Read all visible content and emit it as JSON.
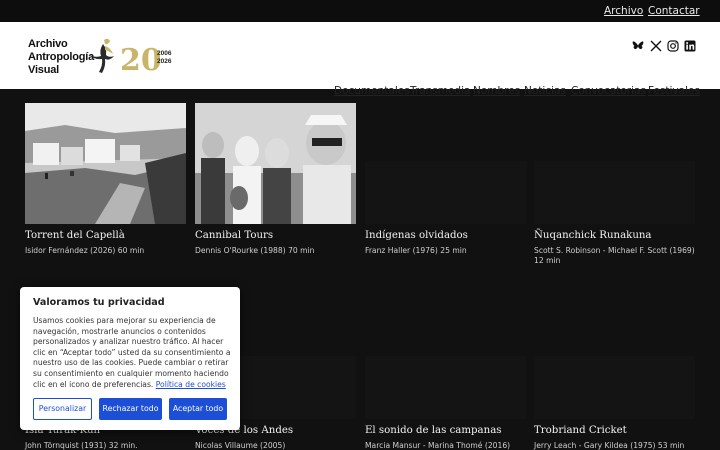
{
  "topbar": {
    "links": [
      "Archivo",
      "Contactar"
    ]
  },
  "header": {
    "logo_lines": [
      "Archivo",
      "Antropología",
      "Visual"
    ],
    "logo_years": [
      "2006",
      "2026"
    ],
    "social_icons": [
      "bluesky-icon",
      "x-icon",
      "instagram-icon",
      "linkedin-icon"
    ],
    "nav": [
      "Documentales",
      "Transmedia",
      "Nombres",
      "Noticias",
      "Convocatorias",
      "Festivales"
    ]
  },
  "films": [
    {
      "title": "Torrent del Capellà",
      "meta": "Isidor Fernández (2026) 60 min"
    },
    {
      "title": "Cannibal Tours",
      "meta": "Dennis O'Rourke (1988) 70 min"
    },
    {
      "title": "Indígenas olvidados",
      "meta": "Franz Haller (1976) 25 min"
    },
    {
      "title": "Ñuqanchick Runakuna",
      "meta": "Scott S. Robinson - Michael F. Scott (1969) 12 min"
    },
    {
      "title": "Isla Yurak-Kuh",
      "meta": "John Törnquist (1931) 32 min."
    },
    {
      "title": "Voces de los Andes",
      "meta": "Nicolas Villaume (2005)"
    },
    {
      "title": "El sonido de las campanas",
      "meta": "Marcia Mansur - Marina Thomé (2016)"
    },
    {
      "title": "Trobriand Cricket",
      "meta": "Jerry Leach - Gary Kildea (1975) 53 min"
    }
  ],
  "cookie": {
    "heading": "Valoramos tu privacidad",
    "body": "Usamos cookies para mejorar su experiencia de navegación, mostrarle anuncios o contenidos personalizados y analizar nuestro tráfico. Al hacer clic en “Aceptar todo” usted da su consentimiento a nuestro uso de las cookies. Puede cambiar o retirar su consentimiento en cualquier momento haciendo clic en el icono de preferencias. ",
    "policy_link": "Política de cookies",
    "buttons": {
      "customize": "Personalizar",
      "reject": "Rechazar todo",
      "accept": "Aceptar todo"
    }
  },
  "colors": {
    "accent": "#1c4fd6",
    "background": "#111111",
    "logo_gold": "#c9b56a"
  }
}
